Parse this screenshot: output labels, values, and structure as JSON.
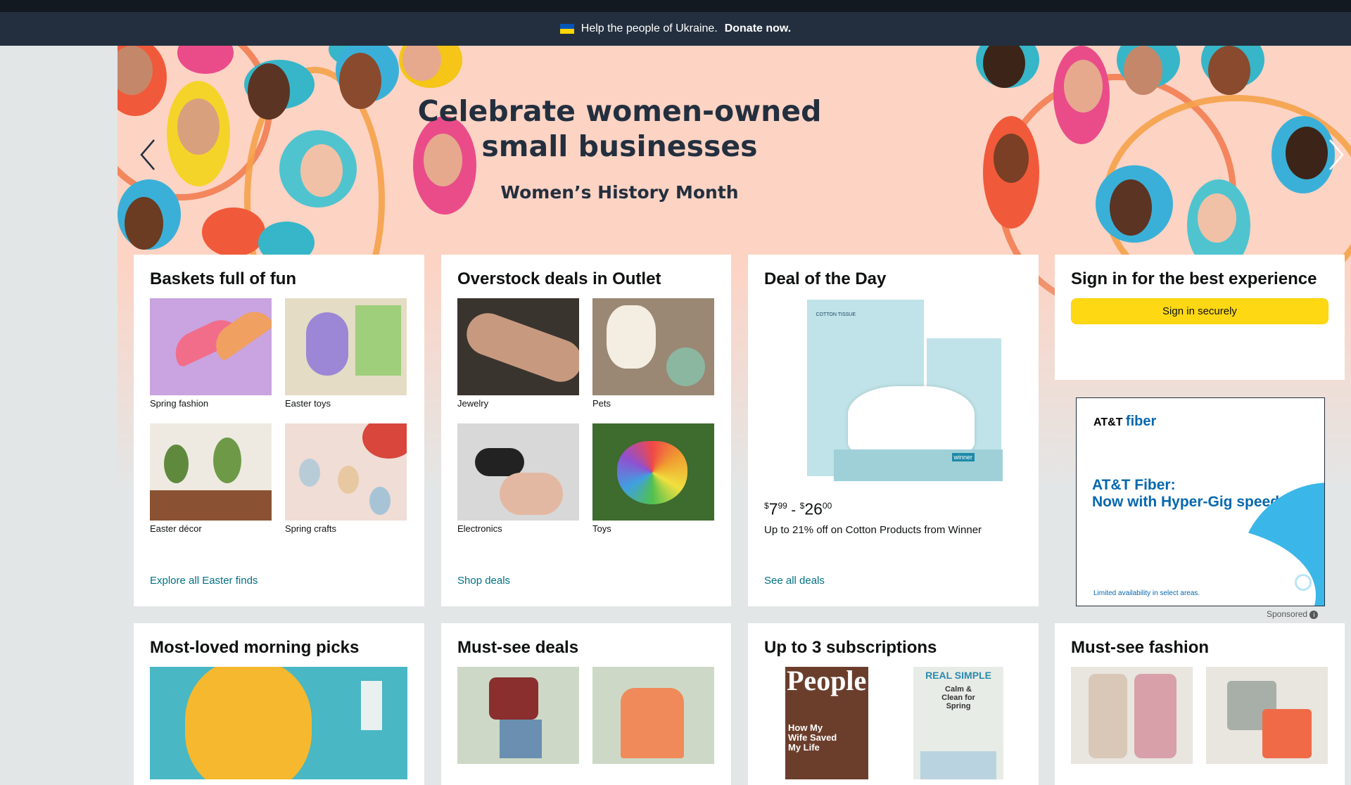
{
  "banner": {
    "text": "Help the people of Ukraine.",
    "link": "Donate now."
  },
  "hero": {
    "title_line1": "Celebrate women-owned",
    "title_line2": "small businesses",
    "subtitle": "Women’s History Month"
  },
  "cards": {
    "baskets": {
      "title": "Baskets full of fun",
      "items": [
        {
          "label": "Spring fashion"
        },
        {
          "label": "Easter toys"
        },
        {
          "label": "Easter décor"
        },
        {
          "label": "Spring crafts"
        }
      ],
      "link": "Explore all Easter finds"
    },
    "overstock": {
      "title": "Overstock deals in Outlet",
      "items": [
        {
          "label": "Jewelry"
        },
        {
          "label": "Pets"
        },
        {
          "label": "Electronics"
        },
        {
          "label": "Toys"
        }
      ],
      "link": "Shop deals"
    },
    "deal": {
      "title": "Deal of the Day",
      "price_low_sym": "$",
      "price_low_whole": "7",
      "price_low_frac": "99",
      "price_sep": " - ",
      "price_high_sym": "$",
      "price_high_whole": "26",
      "price_high_frac": "00",
      "description": "Up to 21% off on Cotton Products from Winner",
      "product_brand": "winner",
      "product_text": "COTTON TISSUE",
      "link": "See all deals"
    },
    "signin": {
      "title": "Sign in for the best experience",
      "button": "Sign in securely"
    },
    "morning": {
      "title": "Most-loved morning picks"
    },
    "mustsee": {
      "title": "Must-see deals"
    },
    "subscriptions": {
      "title": "Up to 3 subscriptions",
      "mag1": "People",
      "mag1_cover": "How My Wife Saved My Life",
      "mag2": "REAL SIMPLE",
      "mag2_cover": "Calm & Clean for Spring"
    },
    "fashion": {
      "title": "Must-see fashion"
    }
  },
  "ad": {
    "brand_att": "AT&T",
    "brand_fiber": "fiber",
    "headline1": "AT&T Fiber:",
    "headline2": "Now with Hyper-Gig speeds",
    "disclaimer": "Limited availability in select areas.",
    "sponsored": "Sponsored",
    "info_icon": "info-icon"
  },
  "icons": {
    "prev": "chevron-left-icon",
    "next": "chevron-right-icon"
  },
  "colors": {
    "nav_dark": "#131921",
    "banner": "#232f3e",
    "hero_bg": "#fdd3c4",
    "link": "#007185",
    "button": "#ffd814",
    "att_blue": "#0568ae"
  }
}
